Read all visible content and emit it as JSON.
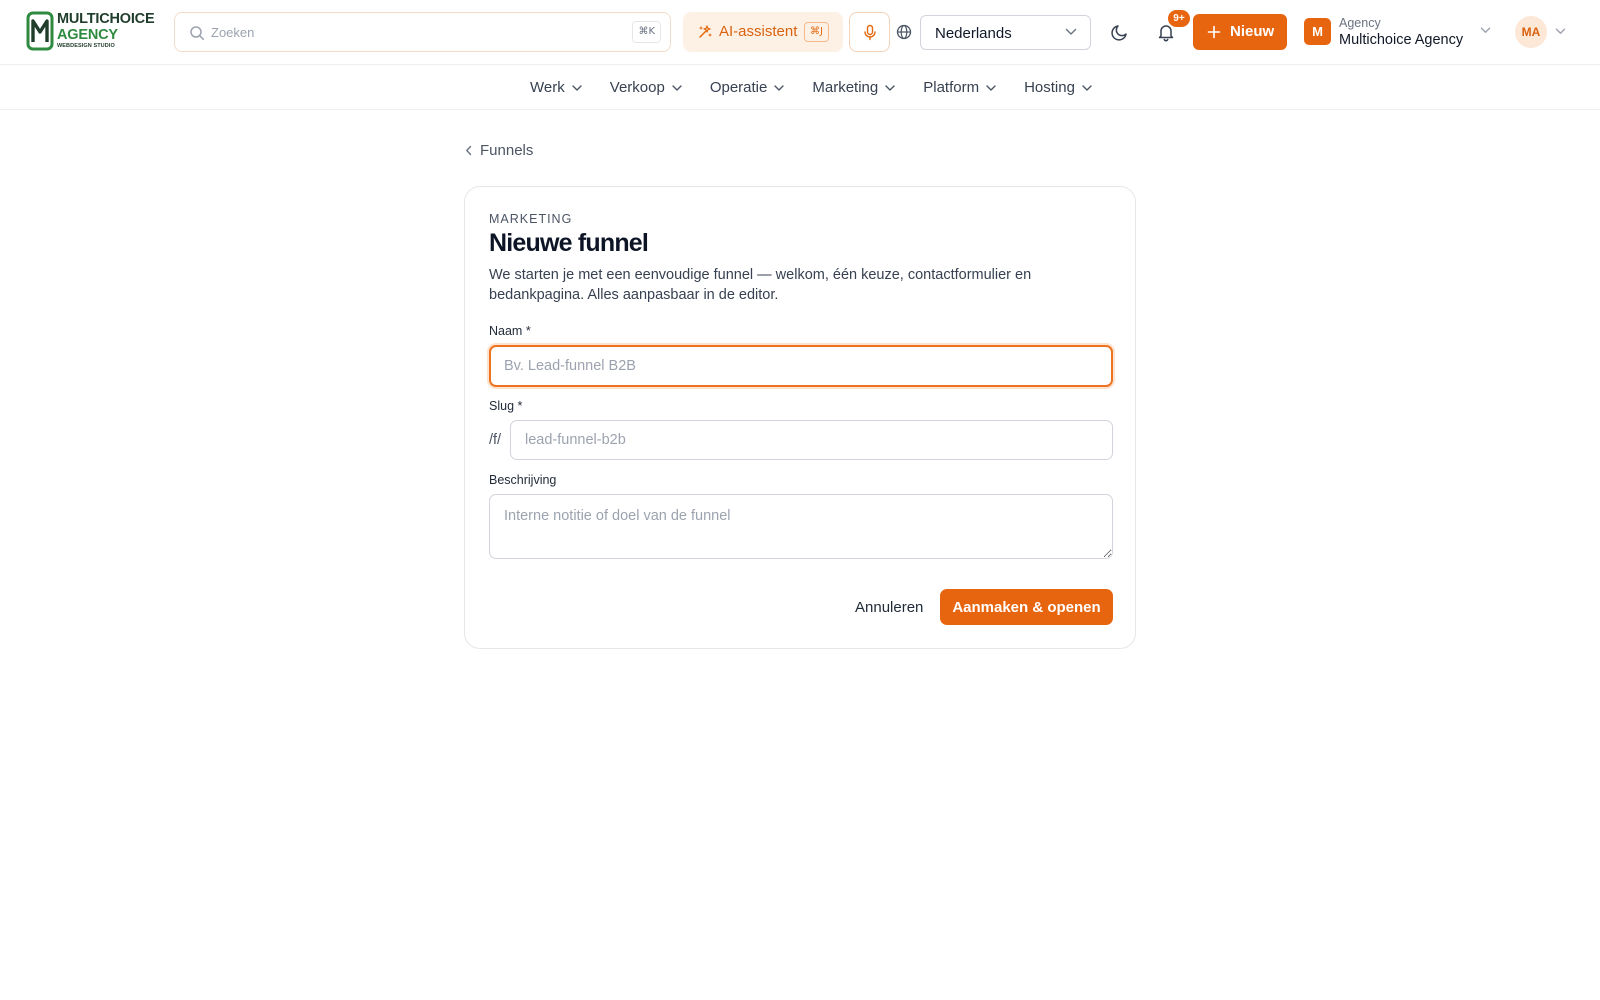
{
  "brand": {
    "line1": "MULTICHOICE",
    "line2": "AGENCY",
    "line3": "WEBDESIGN STUDIO",
    "color_dark": "#1f3d2a",
    "color_green": "#2d8a3e"
  },
  "search": {
    "placeholder": "Zoeken",
    "shortcut": "⌘K"
  },
  "ai_assistant": {
    "label": "AI-assistent",
    "shortcut": "⌘J"
  },
  "language": {
    "selected": "Nederlands"
  },
  "notifications": {
    "badge": "9+"
  },
  "new_button": {
    "label": "Nieuw"
  },
  "agency": {
    "initial": "M",
    "kind": "Agency",
    "name": "Multichoice Agency"
  },
  "user": {
    "initials": "MA"
  },
  "nav": {
    "items": [
      {
        "label": "Werk"
      },
      {
        "label": "Verkoop"
      },
      {
        "label": "Operatie"
      },
      {
        "label": "Marketing"
      },
      {
        "label": "Platform"
      },
      {
        "label": "Hosting"
      }
    ]
  },
  "breadcrumb": {
    "back_label": "Funnels"
  },
  "form": {
    "eyebrow": "MARKETING",
    "title": "Nieuwe funnel",
    "description": "We starten je met een eenvoudige funnel — welkom, één keuze, contactformulier en bedankpagina. Alles aanpasbaar in de editor.",
    "name_label": "Naam *",
    "name_placeholder": "Bv. Lead-funnel B2B",
    "name_value": "",
    "slug_label": "Slug *",
    "slug_prefix": "/f/",
    "slug_placeholder": "lead-funnel-b2b",
    "slug_value": "",
    "desc_label": "Beschrijving",
    "desc_placeholder": "Interne notitie of doel van de funnel",
    "desc_value": "",
    "cancel_label": "Annuleren",
    "submit_label": "Aanmaken & openen"
  },
  "colors": {
    "accent": "#e8650f",
    "accent_soft": "#fdf1e6",
    "focus_ring": "#ec7420",
    "text_dark": "#0d1426"
  },
  "icons": {
    "search": "search-icon",
    "ai": "sparkle-icon",
    "mic": "microphone-icon",
    "globe": "globe-icon",
    "theme": "moon-icon",
    "notifications": "bell-icon",
    "new": "plus-icon",
    "chevron": "chevron-down-icon",
    "back": "chevron-left-icon"
  }
}
